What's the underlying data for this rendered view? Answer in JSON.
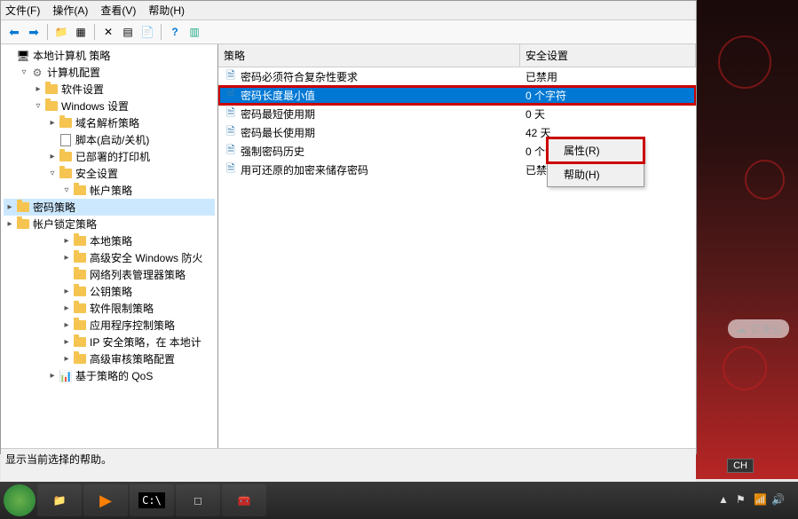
{
  "menu": {
    "file": "文件(F)",
    "action": "操作(A)",
    "view": "查看(V)",
    "help": "帮助(H)"
  },
  "tree": {
    "root": "本地计算机 策略",
    "items": [
      {
        "label": "计算机配置",
        "indent": 1,
        "exp": "▿",
        "ico": "gear"
      },
      {
        "label": "软件设置",
        "indent": 2,
        "exp": "▸",
        "ico": "folder"
      },
      {
        "label": "Windows 设置",
        "indent": 2,
        "exp": "▿",
        "ico": "folder"
      },
      {
        "label": "域名解析策略",
        "indent": 3,
        "exp": "▸",
        "ico": "folder"
      },
      {
        "label": "脚本(启动/关机)",
        "indent": 3,
        "exp": "",
        "ico": "doc"
      },
      {
        "label": "已部署的打印机",
        "indent": 3,
        "exp": "▸",
        "ico": "folder"
      },
      {
        "label": "安全设置",
        "indent": 3,
        "exp": "▿",
        "ico": "folder"
      },
      {
        "label": "帐户策略",
        "indent": 4,
        "exp": "▿",
        "ico": "folder"
      },
      {
        "label": "密码策略",
        "indent": 5,
        "exp": "▸",
        "ico": "folder",
        "sel": true
      },
      {
        "label": "帐户锁定策略",
        "indent": 5,
        "exp": "▸",
        "ico": "folder"
      },
      {
        "label": "本地策略",
        "indent": 4,
        "exp": "▸",
        "ico": "folder"
      },
      {
        "label": "高级安全 Windows 防火",
        "indent": 4,
        "exp": "▸",
        "ico": "folder"
      },
      {
        "label": "网络列表管理器策略",
        "indent": 4,
        "exp": "",
        "ico": "folder"
      },
      {
        "label": "公钥策略",
        "indent": 4,
        "exp": "▸",
        "ico": "folder"
      },
      {
        "label": "软件限制策略",
        "indent": 4,
        "exp": "▸",
        "ico": "folder"
      },
      {
        "label": "应用程序控制策略",
        "indent": 4,
        "exp": "▸",
        "ico": "folder"
      },
      {
        "label": "IP 安全策略，在 本地计",
        "indent": 4,
        "exp": "▸",
        "ico": "folder"
      },
      {
        "label": "高级审核策略配置",
        "indent": 4,
        "exp": "▸",
        "ico": "folder"
      },
      {
        "label": "基于策略的 QoS",
        "indent": 3,
        "exp": "▸",
        "ico": "bars"
      }
    ]
  },
  "columns": {
    "policy": "策略",
    "setting": "安全设置"
  },
  "rows": [
    {
      "name": "密码必须符合复杂性要求",
      "val": "已禁用"
    },
    {
      "name": "密码长度最小值",
      "val": "0 个字符",
      "sel": true,
      "hl": true
    },
    {
      "name": "密码最短使用期",
      "val": "0 天"
    },
    {
      "name": "密码最长使用期",
      "val": "42 天"
    },
    {
      "name": "强制密码历史",
      "val": "0 个记住的密码"
    },
    {
      "name": "用可还原的加密来储存密码",
      "val": "已禁用"
    }
  ],
  "ctx": {
    "properties": "属性(R)",
    "help": "帮助(H)"
  },
  "status": "显示当前选择的帮助。",
  "watermark": "亿速云",
  "tray": {
    "lang": "CH"
  }
}
